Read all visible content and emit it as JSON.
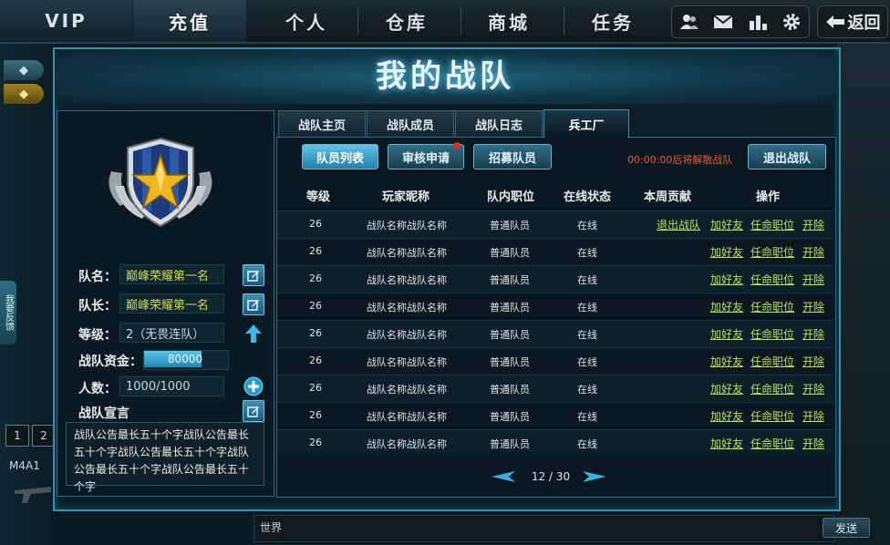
{
  "top_nav": {
    "vip": "VIP",
    "charge": "充值",
    "personal": "个人",
    "warehouse": "仓库",
    "mall": "商城",
    "tasks": "任务",
    "back": "返回"
  },
  "toolbar_icons": [
    "friends-icon",
    "mail-icon",
    "ranking-icon",
    "settings-icon"
  ],
  "panel_title": "我的战队",
  "team_info": {
    "name_label": "队名：",
    "name_value": "巅峰荣耀第一名",
    "leader_label": "队长：",
    "leader_value": "巅峰荣耀第一名",
    "level_label": "等级：",
    "level_value": "2（无畏连队）",
    "funds_label": "战队资金：",
    "funds_value": "80000",
    "funds_fill": 0.7,
    "members_label": "人数：",
    "members_value": "1000/1000",
    "declaration_label": "战队宣言",
    "declaration_text": "战队公告最长五十个字战队公告最长五十个字战队公告最长五十个字战队公告最长五十个字战队公告最长五十个字"
  },
  "tabs": [
    "战队主页",
    "战队成员",
    "战队日志",
    "兵工厂"
  ],
  "sub_buttons": {
    "member_list": "队员列表",
    "review": "审核申请",
    "recruit": "招募队员",
    "quit": "退出战队"
  },
  "countdown_text": "00:00:00后将解散战队",
  "table": {
    "headers": [
      "等级",
      "玩家昵称",
      "队内职位",
      "在线状态",
      "本周贡献",
      "操作"
    ],
    "rows": [
      {
        "level": "26",
        "name": "战队名称战队名称",
        "position": "普通队员",
        "status": "在线",
        "actions": [
          "退出战队",
          "加好友",
          "任命职位",
          "开除"
        ]
      },
      {
        "level": "26",
        "name": "战队名称战队名称",
        "position": "普通队员",
        "status": "在线",
        "actions": [
          "加好友",
          "任命职位",
          "开除"
        ]
      },
      {
        "level": "26",
        "name": "战队名称战队名称",
        "position": "普通队员",
        "status": "在线",
        "actions": [
          "加好友",
          "任命职位",
          "开除"
        ]
      },
      {
        "level": "26",
        "name": "战队名称战队名称",
        "position": "普通队员",
        "status": "在线",
        "actions": [
          "加好友",
          "任命职位",
          "开除"
        ]
      },
      {
        "level": "26",
        "name": "战队名称战队名称",
        "position": "普通队员",
        "status": "在线",
        "actions": [
          "加好友",
          "任命职位",
          "开除"
        ]
      },
      {
        "level": "26",
        "name": "战队名称战队名称",
        "position": "普通队员",
        "status": "在线",
        "actions": [
          "加好友",
          "任命职位",
          "开除"
        ]
      },
      {
        "level": "26",
        "name": "战队名称战队名称",
        "position": "普通队员",
        "status": "在线",
        "actions": [
          "加好友",
          "任命职位",
          "开除"
        ]
      },
      {
        "level": "26",
        "name": "战队名称战队名称",
        "position": "普通队员",
        "status": "在线",
        "actions": [
          "加好友",
          "任命职位",
          "开除"
        ]
      },
      {
        "level": "26",
        "name": "战队名称战队名称",
        "position": "普通队员",
        "status": "在线",
        "actions": [
          "加好友",
          "任命职位",
          "开除"
        ]
      }
    ]
  },
  "pager": "12 / 30",
  "background": {
    "feedback_tab": "我要反馈",
    "page_1": "1",
    "page_2": "2",
    "weapon_name": "M4A1",
    "chat_channel": "世界",
    "send": "发送"
  },
  "colors": {
    "accent": "#3d8fa8",
    "link": "#b7e44a",
    "gold_text": "#cdd94f",
    "warning": "#e45a3b"
  }
}
